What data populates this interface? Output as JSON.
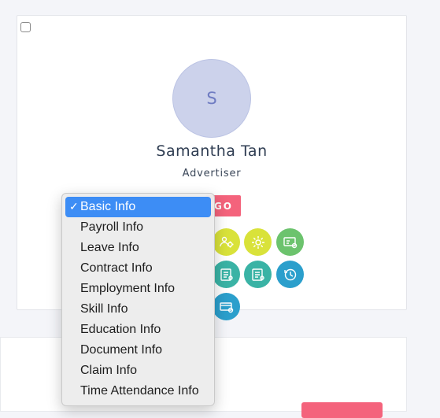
{
  "profile": {
    "avatar_initial": "S",
    "name": "Samantha Tan",
    "role": "Advertiser",
    "go_label": "GO"
  },
  "dropdown": {
    "check_mark": "✓",
    "options": [
      "Basic Info",
      "Payroll Info",
      "Leave Info",
      "Contract Info",
      "Employment Info",
      "Skill Info",
      "Education Info",
      "Document Info",
      "Claim Info",
      "Time Attendance Info"
    ],
    "selected": "Basic Info"
  },
  "action_icons": [
    {
      "name": "people-settings-icon",
      "color": "#d9e23a"
    },
    {
      "name": "gear-icon",
      "color": "#d9e23a"
    },
    {
      "name": "id-card-settings-icon",
      "color": "#6cc36d"
    },
    {
      "name": "document-list-icon",
      "color": "#3ab3a5"
    },
    {
      "name": "document-list-2-icon",
      "color": "#3ab3a5"
    },
    {
      "name": "clock-refresh-icon",
      "color": "#2b9fcc"
    },
    {
      "name": "card-settings-icon",
      "color": "#2b9fcc"
    }
  ],
  "colors": {
    "accent_pink": "#f4637c",
    "selected_blue": "#3d8df5",
    "avatar_bg": "#ccd2eb"
  }
}
